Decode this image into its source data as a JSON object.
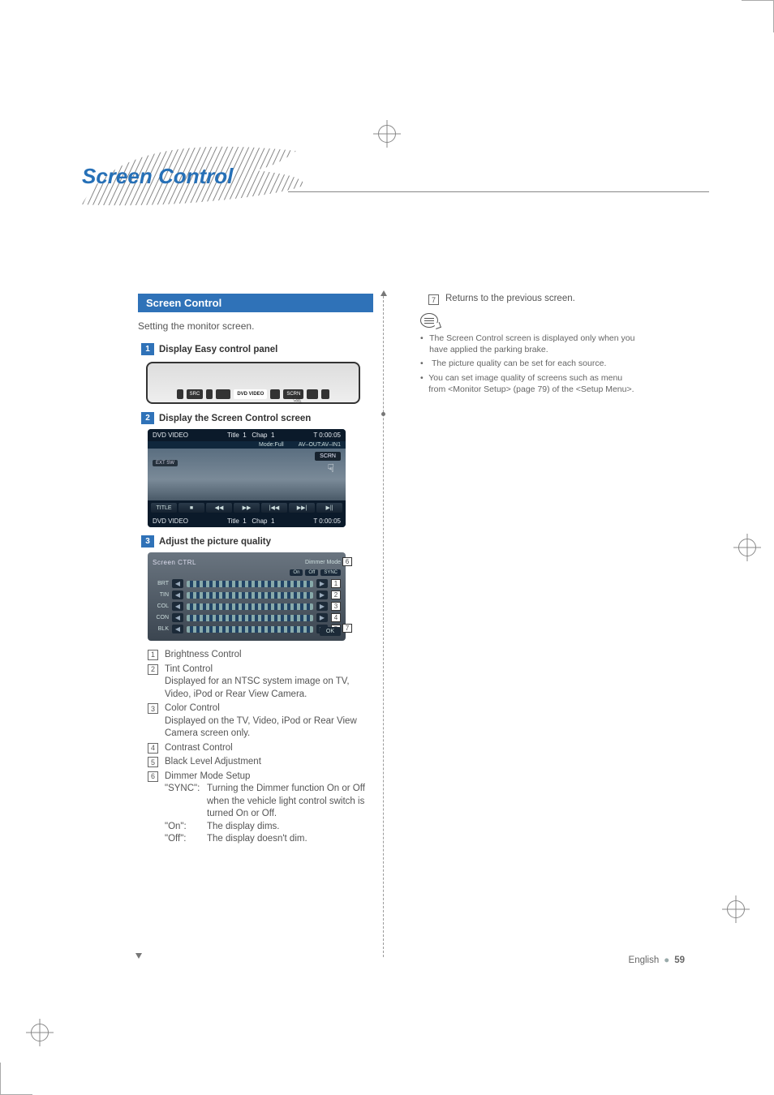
{
  "section_title": "Screen Control",
  "panel_title": "Screen Control",
  "intro": "Setting the monitor screen.",
  "steps": {
    "s1": {
      "num": "1",
      "text": "Display Easy control panel"
    },
    "s2": {
      "num": "2",
      "text": "Display the Screen Control screen"
    },
    "s3": {
      "num": "3",
      "text": "Adjust the picture quality"
    }
  },
  "easy_panel": {
    "buttons": [
      "",
      "SRC",
      "",
      "",
      "DVD VIDEO",
      "",
      "SCRN",
      "",
      ""
    ]
  },
  "shot": {
    "top_left": "DVD VIDEO",
    "top_mid1": "Title",
    "top_mid1v": "1",
    "top_mid2": "Chap",
    "top_mid2v": "1",
    "top_right": "T  0:00:05",
    "sub_mode": "Mode:Full",
    "sub_av": "AV–OUT:AV–IN1",
    "ext": "EXT SW",
    "scrn": "SCRN",
    "ctrl": [
      "TITLE",
      "■",
      "◀◀",
      "▶▶",
      "|◀◀",
      "▶▶|",
      "▶||"
    ],
    "bot_left": "DVD VIDEO",
    "bot_mid1": "Title",
    "bot_mid1v": "1",
    "bot_mid2": "Chap",
    "bot_mid2v": "1",
    "bot_right": "T  0:00:05"
  },
  "adjust": {
    "title": "Screen CTRL",
    "dimmer_label": "Dimmer Mode",
    "dimmer_opts": [
      "On",
      "Off",
      "SYNC"
    ],
    "rows": [
      {
        "label": "BRT",
        "cl": "1"
      },
      {
        "label": "TIN",
        "cl": "2"
      },
      {
        "label": "COL",
        "cl": "3"
      },
      {
        "label": "CON",
        "cl": "4"
      },
      {
        "label": "BLK",
        "cl": "5"
      }
    ],
    "dim_callout": "6",
    "ok": "OK",
    "ok_callout": "7"
  },
  "legend": {
    "i1": {
      "n": "1",
      "t": "Brightness Control"
    },
    "i2": {
      "n": "2",
      "t": "Tint Control",
      "sub": "Displayed for an NTSC system image on TV, Video, iPod or Rear View Camera."
    },
    "i3": {
      "n": "3",
      "t": "Color Control",
      "sub": "Displayed on the TV, Video, iPod or Rear View Camera screen only."
    },
    "i4": {
      "n": "4",
      "t": "Contrast Control"
    },
    "i5": {
      "n": "5",
      "t": "Black Level Adjustment"
    },
    "i6": {
      "n": "6",
      "t": "Dimmer Mode Setup",
      "kv": [
        {
          "k": "\"SYNC\":",
          "v": "Turning the Dimmer function On or Off when the vehicle light control switch is turned On or Off."
        },
        {
          "k": "\"On\":",
          "v": "The display dims."
        },
        {
          "k": "\"Off\":",
          "v": "The display doesn't dim."
        }
      ]
    }
  },
  "right": {
    "ret_n": "7",
    "ret_t": "Returns to the previous screen.",
    "notes": [
      "The Screen Control screen is displayed only when you have applied the parking brake.",
      "The picture quality can be set for each source.",
      "You can set image quality of screens such as menu from <Monitor Setup> (page 79) of the <Setup Menu>."
    ]
  },
  "footer": {
    "lang": "English",
    "page": "59"
  }
}
